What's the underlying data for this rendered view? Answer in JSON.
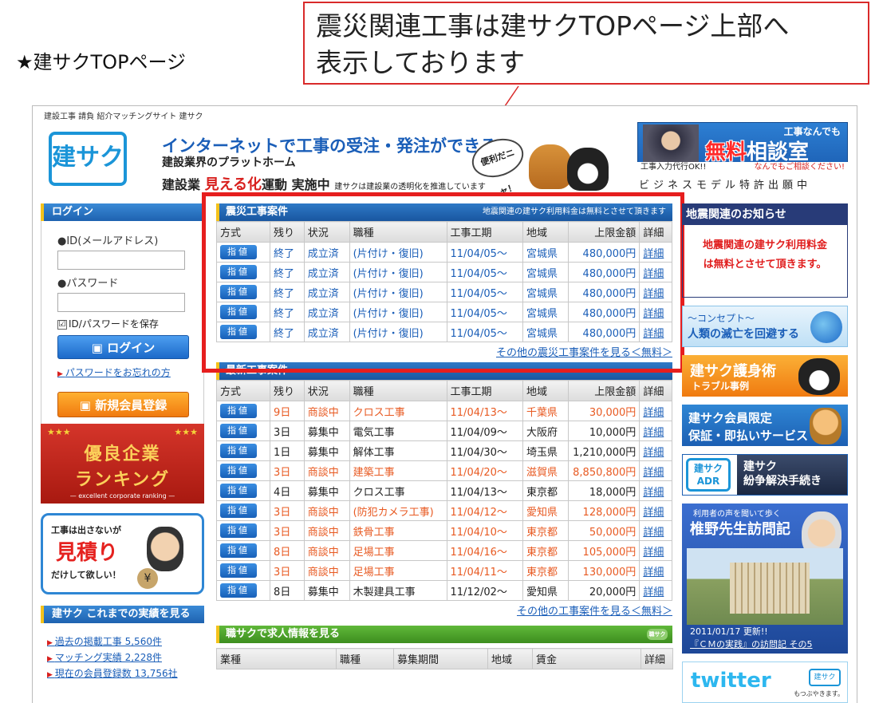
{
  "annotation": {
    "heading": "★建サクTOPページ",
    "callout_lines": [
      "震災関連工事は建サクTOPページ上部へ",
      "表示しております"
    ]
  },
  "header": {
    "tagline": "建設工事 請負 紹介マッチングサイト 建サク",
    "logo_text": "建サク",
    "main_copy": "インターネットで工事の受注・発注ができる",
    "sub_copy": "建設業界のプラットホーム",
    "campaign_pre": "建設業 ",
    "campaign_red": "見える化",
    "campaign_post": "運動 実施中",
    "campaign_note": "建サクは建設業の透明化を推進しています",
    "bubble": "便利だニャ！",
    "ad_top": "工事なんでも",
    "ad_red": "無料",
    "ad_white": "相談室",
    "ad_left": "工事入力代行OK!!",
    "ad_right": "なんでもご相談ください!",
    "patent": "ビジネスモデル特許出願中"
  },
  "login": {
    "title": "ログイン",
    "id_label": "●ID(メールアドレス)",
    "password_label": "●パスワード",
    "save_label": "ID/パスワードを保存",
    "save_checked": "☑",
    "login_button": "ログイン",
    "forgot_link": "パスワードをお忘れの方",
    "register_button": "新規会員登録"
  },
  "left_banners": {
    "ranking_stars_left": "★★★",
    "ranking_stars_right": "★★★",
    "ranking_line1": "優良企業",
    "ranking_line2": "ランキング",
    "ranking_sub": "— excellent corporate ranking —",
    "estimate_line1": "工事は出さないが",
    "estimate_line2": "見積り",
    "estimate_line3": "だけして欲しい！",
    "estimate_yen": "¥"
  },
  "results": {
    "title": "建サク これまでの実績を見る",
    "items": [
      "過去の掲載工事 5,560件",
      "マッチング実績 2,228件",
      "現在の会員登録数 13,756社"
    ]
  },
  "quake_jobs": {
    "title": "震災工事案件",
    "note": "地震関連の建サク利用料金は無料とさせて頂きます",
    "columns": [
      "方式",
      "残り",
      "状況",
      "職種",
      "工事工期",
      "地域",
      "上限金額",
      "詳細"
    ],
    "rows": [
      {
        "method": "指値",
        "remaining": "終了",
        "status": "成立済",
        "category": "(片付け・復旧)",
        "period": "11/04/05〜",
        "region": "宮城県",
        "amount": "480,000円",
        "detail": "詳細"
      },
      {
        "method": "指値",
        "remaining": "終了",
        "status": "成立済",
        "category": "(片付け・復旧)",
        "period": "11/04/05〜",
        "region": "宮城県",
        "amount": "480,000円",
        "detail": "詳細"
      },
      {
        "method": "指値",
        "remaining": "終了",
        "status": "成立済",
        "category": "(片付け・復旧)",
        "period": "11/04/05〜",
        "region": "宮城県",
        "amount": "480,000円",
        "detail": "詳細"
      },
      {
        "method": "指値",
        "remaining": "終了",
        "status": "成立済",
        "category": "(片付け・復旧)",
        "period": "11/04/05〜",
        "region": "宮城県",
        "amount": "480,000円",
        "detail": "詳細"
      },
      {
        "method": "指値",
        "remaining": "終了",
        "status": "成立済",
        "category": "(片付け・復旧)",
        "period": "11/04/05〜",
        "region": "宮城県",
        "amount": "480,000円",
        "detail": "詳細"
      }
    ],
    "more_link": "その他の震災工事案件を見る＜無料＞"
  },
  "latest_jobs": {
    "title": "最新工事案件",
    "columns": [
      "方式",
      "残り",
      "状況",
      "職種",
      "工事工期",
      "地域",
      "上限金額",
      "詳細"
    ],
    "rows": [
      {
        "method": "指値",
        "remaining": "9日",
        "status": "商談中",
        "category": "クロス工事",
        "period": "11/04/13〜",
        "region": "千葉県",
        "amount": "30,000円",
        "detail": "詳細",
        "tone": "orange"
      },
      {
        "method": "指値",
        "remaining": "3日",
        "status": "募集中",
        "category": "電気工事",
        "period": "11/04/09〜",
        "region": "大阪府",
        "amount": "10,000円",
        "detail": "詳細",
        "tone": "dark"
      },
      {
        "method": "指値",
        "remaining": "1日",
        "status": "募集中",
        "category": "解体工事",
        "period": "11/04/30〜",
        "region": "埼玉県",
        "amount": "1,210,000円",
        "detail": "詳細",
        "tone": "dark"
      },
      {
        "method": "指値",
        "remaining": "3日",
        "status": "商談中",
        "category": "建築工事",
        "period": "11/04/20〜",
        "region": "滋賀県",
        "amount": "8,850,800円",
        "detail": "詳細",
        "tone": "orange"
      },
      {
        "method": "指値",
        "remaining": "4日",
        "status": "募集中",
        "category": "クロス工事",
        "period": "11/04/13〜",
        "region": "東京都",
        "amount": "18,000円",
        "detail": "詳細",
        "tone": "dark"
      },
      {
        "method": "指値",
        "remaining": "3日",
        "status": "商談中",
        "category": "(防犯カメラ工事)",
        "period": "11/04/12〜",
        "region": "愛知県",
        "amount": "128,000円",
        "detail": "詳細",
        "tone": "orange"
      },
      {
        "method": "指値",
        "remaining": "3日",
        "status": "商談中",
        "category": "鉄骨工事",
        "period": "11/04/10〜",
        "region": "東京都",
        "amount": "50,000円",
        "detail": "詳細",
        "tone": "orange"
      },
      {
        "method": "指値",
        "remaining": "8日",
        "status": "商談中",
        "category": "足場工事",
        "period": "11/04/16〜",
        "region": "東京都",
        "amount": "105,000円",
        "detail": "詳細",
        "tone": "orange"
      },
      {
        "method": "指値",
        "remaining": "3日",
        "status": "商談中",
        "category": "足場工事",
        "period": "11/04/11〜",
        "region": "東京都",
        "amount": "130,000円",
        "detail": "詳細",
        "tone": "orange"
      },
      {
        "method": "指値",
        "remaining": "8日",
        "status": "募集中",
        "category": "木製建具工事",
        "period": "11/12/02〜",
        "region": "愛知県",
        "amount": "20,000円",
        "detail": "詳細",
        "tone": "dark"
      }
    ],
    "more_link": "その他の工事案件を見る＜無料＞"
  },
  "recruit": {
    "title": "職サクで求人情報を見る",
    "tag": "職サク",
    "columns": [
      "業種",
      "職種",
      "募集期間",
      "地域",
      "賃金",
      "詳細"
    ]
  },
  "right": {
    "quake_title": "地震関連のお知らせ",
    "quake_line1": "地震関連の建サク利用料金",
    "quake_line2": "は無料とさせて頂きます。",
    "concept_line1": "〜コンセプト〜",
    "concept_line2": "人類の滅亡を回避する",
    "protect_line1": "建サク護身術",
    "protect_line2": "トラブル事例",
    "member_line1": "建サク会員限定",
    "member_line2": "保証・即払いサービス",
    "adr_logo": "建サク",
    "adr_logo_sub": "ADR",
    "adr_line1": "建サク",
    "adr_line2": "紛争解決手続き",
    "visit_line1": "利用者の声を聞いて歩く",
    "visit_line2": "椎野先生訪問記",
    "visit_date": "2011/01/17 更新!!",
    "visit_link": "『ＣＭの実践』の訪問記 その5",
    "twitter": "twitter",
    "twitter_logo": "建サク",
    "twitter_sub": "もつぶやきます。"
  }
}
